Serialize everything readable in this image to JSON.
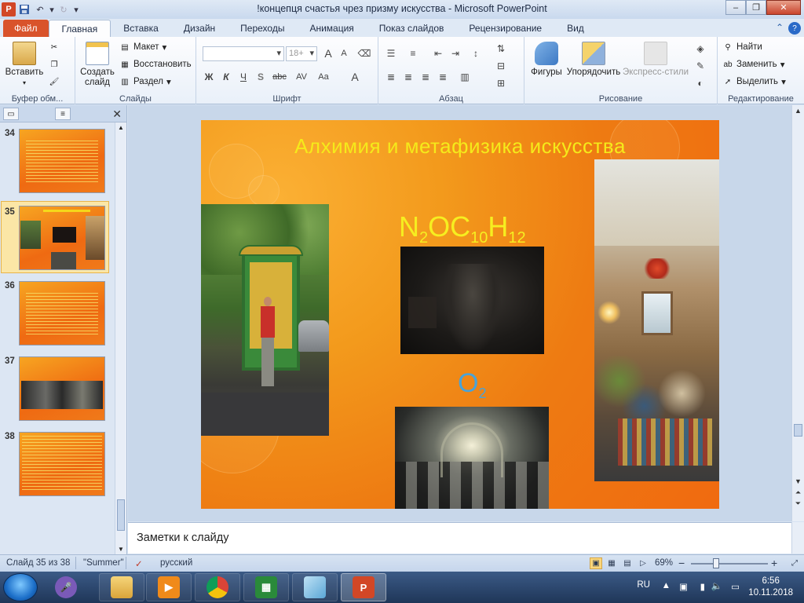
{
  "window": {
    "title": "!концепця счастья чрез призму искусства  -  Microsoft PowerPoint",
    "app_icon_letter": "P",
    "controls": {
      "minimize": "–",
      "restore": "❐",
      "close": "✕"
    }
  },
  "ribbon_tabs": {
    "file": "Файл",
    "items": [
      "Главная",
      "Вставка",
      "Дизайн",
      "Переходы",
      "Анимация",
      "Показ слайдов",
      "Рецензирование",
      "Вид"
    ],
    "active_index": 0
  },
  "ribbon": {
    "clipboard": {
      "paste": "Вставить",
      "label": "Буфер обм..."
    },
    "slides": {
      "new_slide_line1": "Создать",
      "new_slide_line2": "слайд",
      "layout": "Макет",
      "reset": "Восстановить",
      "section": "Раздел",
      "label": "Слайды"
    },
    "font": {
      "font_size": "18+",
      "bold": "Ж",
      "italic": "К",
      "underline": "Ч",
      "shadow": "S",
      "strike": "abc",
      "spacing": "AV",
      "case": "Aa",
      "color": "A",
      "grow": "A",
      "shrink": "A",
      "label": "Шрифт"
    },
    "paragraph": {
      "label": "Абзац"
    },
    "drawing": {
      "shapes": "Фигуры",
      "arrange": "Упорядочить",
      "quick_styles": "Экспресс-стили",
      "label": "Рисование"
    },
    "editing": {
      "find": "Найти",
      "replace": "Заменить",
      "select": "Выделить",
      "label": "Редактирование"
    }
  },
  "thumbnails": {
    "slides": [
      {
        "num": "34"
      },
      {
        "num": "35",
        "selected": true
      },
      {
        "num": "36"
      },
      {
        "num": "37"
      },
      {
        "num": "38"
      }
    ]
  },
  "slide": {
    "title": "Алхимия и метафизика искусства",
    "formula_parts": [
      "N",
      "2",
      "OC",
      "10",
      "H",
      "12"
    ],
    "o2_parts": [
      "O",
      "2"
    ]
  },
  "notes": {
    "placeholder": "Заметки к слайду"
  },
  "statusbar": {
    "slide_pos": "Слайд 35 из 38",
    "theme": "\"Summer\"",
    "language": "русский",
    "zoom": "69%",
    "zoom_minus": "−",
    "zoom_plus": "+"
  },
  "taskbar": {
    "lang": "RU",
    "time": "6:56",
    "date": "10.11.2018"
  },
  "colors": {
    "slide_orange": "#ee7b12",
    "title_yellow": "#f5ea1a",
    "o2_blue": "#4aa3d8",
    "file_tab": "#d9532b"
  }
}
